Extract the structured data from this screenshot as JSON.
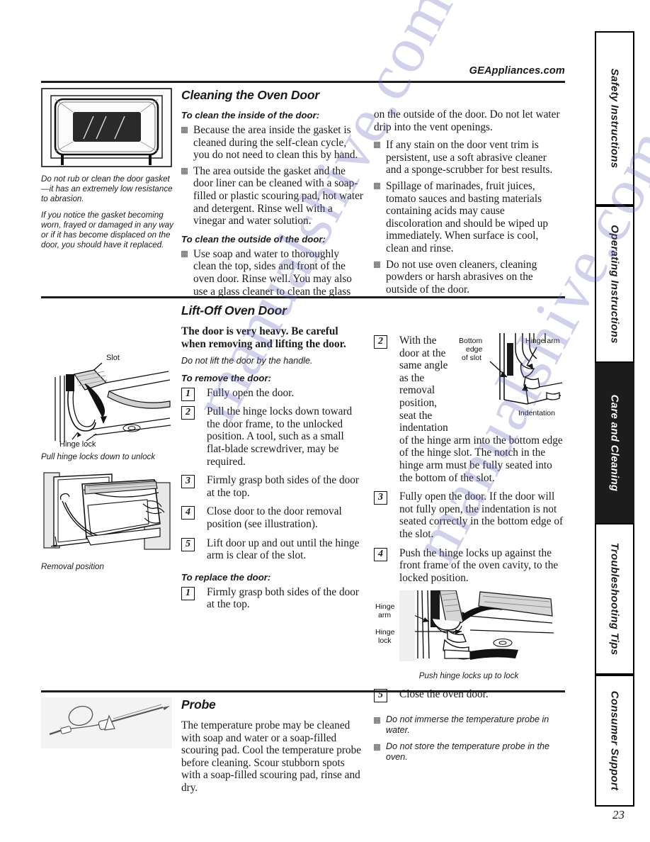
{
  "header": {
    "site": "GEAppliances.com"
  },
  "page_number": "23",
  "tabs": [
    {
      "label": "Safety Instructions",
      "active": false
    },
    {
      "label": "Operating Instructions",
      "active": false
    },
    {
      "label": "Care and Cleaning",
      "active": true
    },
    {
      "label": "Troubleshooting Tips",
      "active": false
    },
    {
      "label": "Consumer Support",
      "active": false
    }
  ],
  "sections": {
    "cleaning_door": {
      "title": "Cleaning the Oven Door",
      "figure_caption_1": "Do not rub or clean the door gasket—it has an extremely low resistance to abrasion.",
      "figure_caption_2": "If you notice the gasket becoming worn, frayed or damaged in any way or if it has become displaced on the door, you should have it replaced.",
      "sub_inside": "To clean the inside of the door:",
      "inside_bullets": [
        "Because the area inside the gasket is cleaned during the self-clean cycle, you do not need to clean this by hand.",
        "The area outside the gasket and the door liner can be cleaned with a soap-filled or plastic scouring pad, hot water and detergent. Rinse well with a vinegar and water solution."
      ],
      "sub_outside": "To clean the outside of the door:",
      "outside_bullets": [
        "Use soap and water to thoroughly clean the top, sides and front of the oven door. Rinse well. You may also use a glass cleaner to clean the glass"
      ],
      "right_continuation": "on the outside of the door. Do not let water drip into the vent openings.",
      "right_bullets": [
        "If any stain on the door vent trim is persistent, use a soft abrasive cleaner and a sponge-scrubber for best results.",
        "Spillage of marinades, fruit juices, tomato sauces and basting materials containing acids may cause discoloration and should be wiped up immediately. When surface is cool, clean and rinse.",
        "Do not use oven cleaners, cleaning powders or harsh abrasives on the outside of the door."
      ]
    },
    "lift_off_door": {
      "title": "Lift-Off Oven Door",
      "warning": "The door is very heavy. Be careful when removing and lifting the door.",
      "note": "Do not lift the door by the handle.",
      "sub_remove": "To remove the door:",
      "remove_steps": [
        {
          "num": "1",
          "text": "Fully open the door."
        },
        {
          "num": "2",
          "text": "Pull the hinge locks down toward the door frame, to the unlocked position. A tool, such as a small flat-blade screwdriver, may be required."
        },
        {
          "num": "3",
          "text": "Firmly grasp both sides of the door at the top."
        },
        {
          "num": "4",
          "text": "Close door to the door removal position (see illustration)."
        },
        {
          "num": "5",
          "text": "Lift door up and out until the hinge arm is clear of the slot."
        }
      ],
      "sub_replace": "To replace the door:",
      "replace_steps_left": [
        {
          "num": "1",
          "text": "Firmly grasp both sides of the door at the top."
        }
      ],
      "replace_steps_right": [
        {
          "num": "2",
          "text": "With the door at the same angle as the removal position, seat the indentation of the hinge arm into the bottom edge of the hinge slot. The notch in the hinge arm must be fully seated into the bottom of the slot."
        },
        {
          "num": "3",
          "text": "Fully open the door. If the door will not fully open, the indentation is not seated correctly in the bottom edge of the slot."
        },
        {
          "num": "4",
          "text": "Push the hinge locks up against the front frame of the oven cavity, to the locked position."
        },
        {
          "num": "5",
          "text": "Close the oven door."
        }
      ],
      "fig_slot_label": "Slot",
      "fig_hingelock_label": "Hinge lock",
      "fig_unlock_caption": "Pull hinge locks down to unlock",
      "fig_removal_caption": "Removal position",
      "fig_bottom_edge_label": "Bottom edge of slot",
      "fig_hinge_arm_label": "Hinge arm",
      "fig_indentation_label": "Indentation",
      "fig_hinge_arm_label2": "Hinge arm",
      "fig_hinge_lock_label2": "Hinge lock",
      "fig_lock_caption": "Push hinge locks up to lock"
    },
    "probe": {
      "title": "Probe",
      "body": "The temperature probe may be cleaned with soap and water or a soap-filled scouring pad. Cool the temperature probe before cleaning. Scour stubborn spots with a soap-filled scouring pad, rinse and dry.",
      "bullets": [
        "Do not immerse the temperature probe in water.",
        "Do not store the temperature probe in the oven."
      ]
    }
  },
  "watermark": {
    "line1": "manualshive.com",
    "line2": "manualshive.com"
  },
  "colors": {
    "rule": "#1d1d1d",
    "active_tab_bg": "#1c1c1c",
    "watermark": "#6a6ac0"
  }
}
